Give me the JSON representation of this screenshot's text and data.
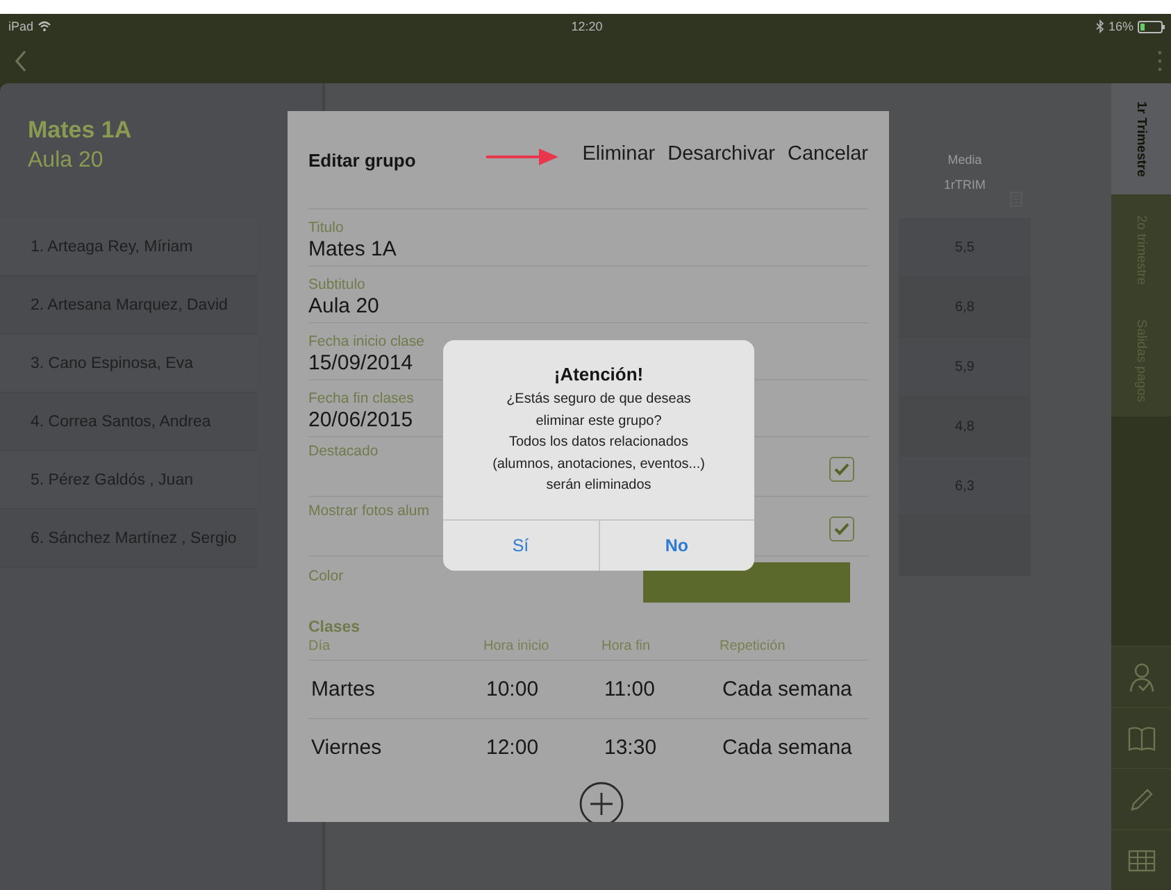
{
  "status_bar": {
    "device": "iPad",
    "time": "12:20",
    "battery": "16%"
  },
  "group": {
    "title": "Mates 1A",
    "subtitle": "Aula 20"
  },
  "students": [
    {
      "name": "1. Arteaga Rey, Míriam",
      "grade": "5,5"
    },
    {
      "name": "2. Artesana Marquez, David",
      "grade": "6,8"
    },
    {
      "name": "3. Cano Espinosa, Eva",
      "grade": "5,9"
    },
    {
      "name": "4. Correa Santos, Andrea",
      "grade": "4,8"
    },
    {
      "name": "5. Pérez Galdós , Juan",
      "grade": "6,3"
    },
    {
      "name": "6. Sánchez Martínez , Sergio"
    }
  ],
  "grade_column": {
    "header": "Media",
    "subheader": "1rTRIM"
  },
  "side_tabs": [
    {
      "label": "1r Trimestre",
      "selected": true
    },
    {
      "label": "2o trimestre",
      "selected": false
    },
    {
      "label": "Salidas pagos",
      "selected": false
    }
  ],
  "side_tools": [
    {
      "kind": "students"
    },
    {
      "kind": "book"
    },
    {
      "kind": "pencil"
    },
    {
      "kind": "grid"
    }
  ],
  "edit_dialog": {
    "title": "Editar grupo",
    "actions": [
      "Eliminar",
      "Desarchivar",
      "Cancelar"
    ],
    "fields": [
      {
        "kind": "text",
        "label": "Titulo",
        "value": "Mates 1A"
      },
      {
        "kind": "text",
        "label": "Subtitulo",
        "value": "Aula 20"
      },
      {
        "kind": "text",
        "label": "Fecha inicio clase",
        "value": "15/09/2014"
      },
      {
        "kind": "text",
        "label": "Fecha fin clases",
        "value": "20/06/2015"
      },
      {
        "kind": "check",
        "label": "Destacado",
        "checked": true
      },
      {
        "kind": "check",
        "label": "Mostrar fotos alum",
        "checked": true
      },
      {
        "kind": "color",
        "label": "Color",
        "color": "#5b6a2c"
      }
    ],
    "classes": {
      "title": "Clases",
      "columns": [
        "Día",
        "Hora inicio",
        "Hora fin",
        "Repetición"
      ],
      "rows": [
        [
          "Martes",
          "10:00",
          "11:00",
          "Cada semana"
        ],
        [
          "Viernes",
          "12:00",
          "13:30",
          "Cada semana"
        ]
      ]
    }
  },
  "alert": {
    "title": "¡Atención!",
    "message": [
      "¿Estás seguro de que deseas",
      "eliminar este grupo?",
      "Todos los datos relacionados",
      "(alumnos, anotaciones, eventos...)",
      "serán eliminados"
    ],
    "buttons": [
      {
        "label": "Sí",
        "kind": "default"
      },
      {
        "label": "No",
        "kind": "bold"
      }
    ]
  }
}
